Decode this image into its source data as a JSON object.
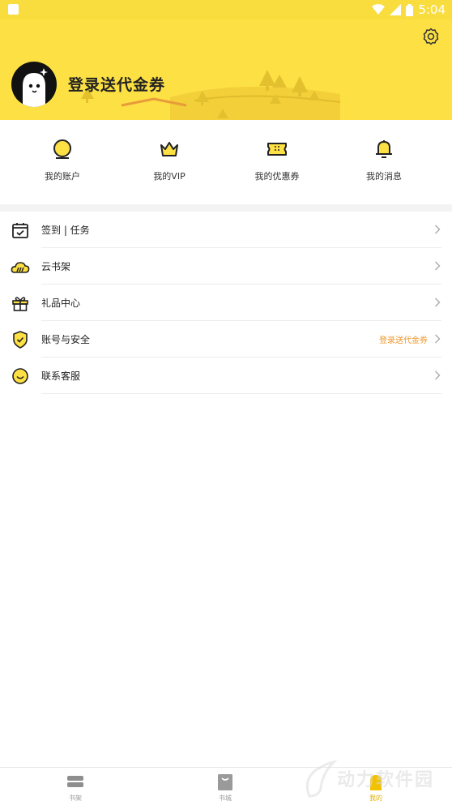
{
  "status_bar": {
    "time": "5:04"
  },
  "header": {
    "login_title": "登录送代金券"
  },
  "quick_actions": [
    {
      "label": "我的账户",
      "icon": "coin-icon"
    },
    {
      "label": "我的VIP",
      "icon": "crown-icon"
    },
    {
      "label": "我的优惠券",
      "icon": "ticket-icon"
    },
    {
      "label": "我的消息",
      "icon": "bell-icon"
    }
  ],
  "menu": [
    {
      "label": "签到 | 任务",
      "icon": "calendar-check-icon",
      "hint": ""
    },
    {
      "label": "云书架",
      "icon": "cloud-books-icon",
      "hint": ""
    },
    {
      "label": "礼品中心",
      "icon": "gift-icon",
      "hint": ""
    },
    {
      "label": "账号与安全",
      "icon": "shield-check-icon",
      "hint": "登录送代金券"
    },
    {
      "label": "联系客服",
      "icon": "smile-icon",
      "hint": ""
    }
  ],
  "tabbar": {
    "items": [
      {
        "label": "书架",
        "icon": "bookshelf-icon"
      },
      {
        "label": "书城",
        "icon": "bookstore-icon"
      },
      {
        "label": "我的",
        "icon": "profile-icon"
      }
    ]
  },
  "watermark": {
    "text": "动力软件园"
  },
  "colors": {
    "header_yellow": "#fde043",
    "accent_orange": "#f0972a",
    "tab_active": "#e4b100"
  }
}
